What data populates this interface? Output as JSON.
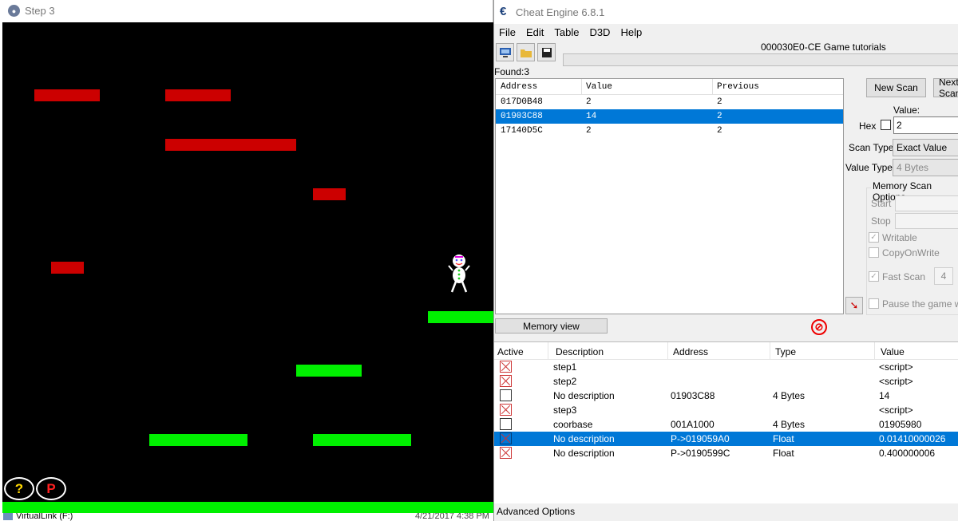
{
  "game": {
    "title": "Step 3",
    "help_button": "?",
    "pause_button": "P"
  },
  "background": {
    "drive_label": "VirtualLink (F:)",
    "date_fragment": "4/21/2017 4:38 PM"
  },
  "cheat_engine": {
    "title": "Cheat Engine 6.8.1",
    "menu": [
      "File",
      "Edit",
      "Table",
      "D3D",
      "Help"
    ],
    "process": "000030E0-CE Game tutorials",
    "found": "Found:3",
    "scan_columns": [
      "Address",
      "Value",
      "Previous"
    ],
    "scan_results": [
      {
        "address": "017D0B48",
        "value": "2",
        "previous": "2"
      },
      {
        "address": "01903C88",
        "value": "14",
        "previous": "2"
      },
      {
        "address": "17140D5C",
        "value": "2",
        "previous": "2"
      }
    ],
    "new_scan": "New Scan",
    "next_scan": "Next Scan",
    "value_label": "Value:",
    "hex_label": "Hex",
    "value_input": "2",
    "scan_type_label": "Scan Type",
    "scan_type_value": "Exact Value",
    "value_type_label": "Value Type",
    "value_type_value": "4 Bytes",
    "memory_options": "Memory Scan Options",
    "start_label": "Start",
    "stop_label": "Stop",
    "writable": "Writable",
    "copy_on_write": "CopyOnWrite",
    "fast_scan": "Fast Scan",
    "fast_scan_value": "4",
    "pause_game": "Pause the game while scanning",
    "memory_view": "Memory view",
    "addr_columns": [
      "Active",
      "Description",
      "Address",
      "Type",
      "Value"
    ],
    "address_list": [
      {
        "description": "step1",
        "address": "",
        "type": "",
        "value": "<script>",
        "kind": "script"
      },
      {
        "description": "step2",
        "address": "",
        "type": "",
        "value": "<script>",
        "kind": "script"
      },
      {
        "description": "No description",
        "address": "01903C88",
        "type": "4 Bytes",
        "value": "14",
        "kind": "plain"
      },
      {
        "description": "step3",
        "address": "",
        "type": "",
        "value": "<script>",
        "kind": "script"
      },
      {
        "description": "coorbase",
        "address": "001A1000",
        "type": "4 Bytes",
        "value": "01905980",
        "kind": "plain"
      },
      {
        "description": "No description",
        "address": "P->019059A0",
        "type": "Float",
        "value": "0.01410000026",
        "kind": "selected"
      },
      {
        "description": "No description",
        "address": "P->0190599C",
        "type": "Float",
        "value": "0.400000006",
        "kind": "script"
      }
    ],
    "advanced_options": "Advanced Options"
  },
  "colors": {
    "selection": "#0078d7",
    "red_platform": "#cc0000",
    "green_platform": "#00f000"
  }
}
